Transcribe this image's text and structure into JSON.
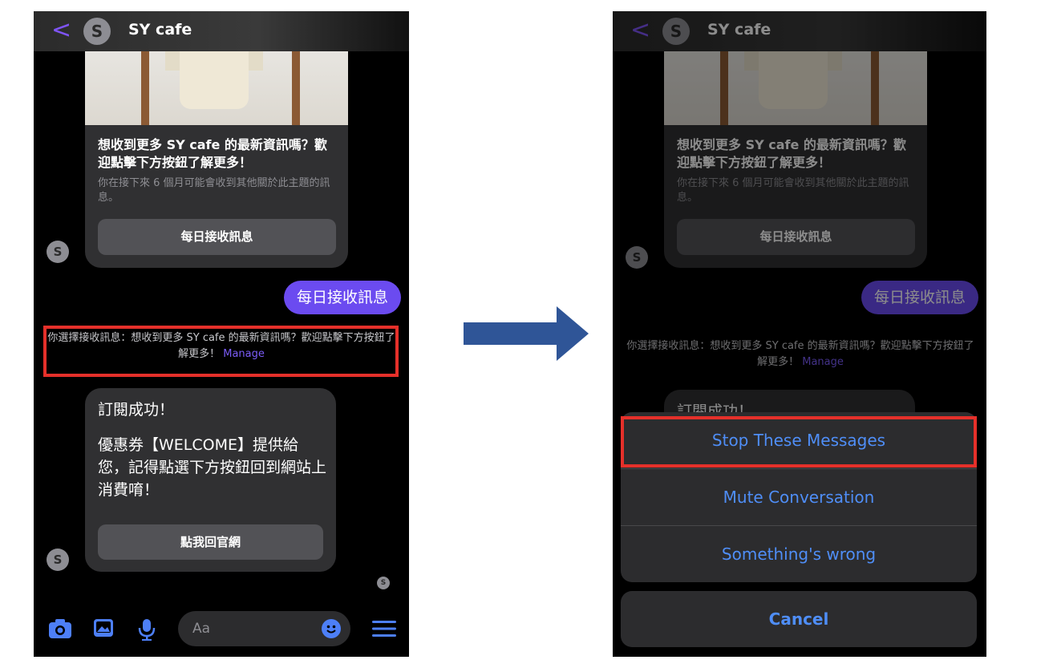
{
  "chat": {
    "back_glyph": "<",
    "avatar_letter": "S",
    "title": "SY cafe"
  },
  "card1": {
    "title": "想收到更多 SY cafe 的最新資訊嗎？歡迎點擊下方按鈕了解更多！",
    "subtitle": "你在接下來 6 個月可能會收到其他關於此主題的訊息。",
    "button": "每日接收訊息"
  },
  "user_reply": "每日接收訊息",
  "notice": {
    "text": "你選擇接收訊息：想收到更多 SY cafe 的最新資訊嗎？歡迎點擊下方按鈕了解更多！",
    "link": "Manage"
  },
  "card2": {
    "line1": "訂閱成功！",
    "line2": "優惠券【WELCOME】提供給您，記得點選下方按鈕回到網站上消費唷！",
    "button": "點我回官網"
  },
  "read_receipt_letter": "S",
  "composer": {
    "placeholder": "Aa"
  },
  "action_sheet": {
    "options": [
      "Stop These Messages",
      "Mute Conversation",
      "Something's wrong"
    ],
    "cancel": "Cancel"
  },
  "colors": {
    "accent": "#7f54f5",
    "user_bubble": "#6b4bf0",
    "ios_blue": "#4f8ef7",
    "highlight": "#e5302a"
  },
  "icons": [
    "back-icon",
    "camera-icon",
    "gallery-icon",
    "microphone-icon",
    "emoji-icon",
    "menu-icon",
    "arrow-icon"
  ]
}
